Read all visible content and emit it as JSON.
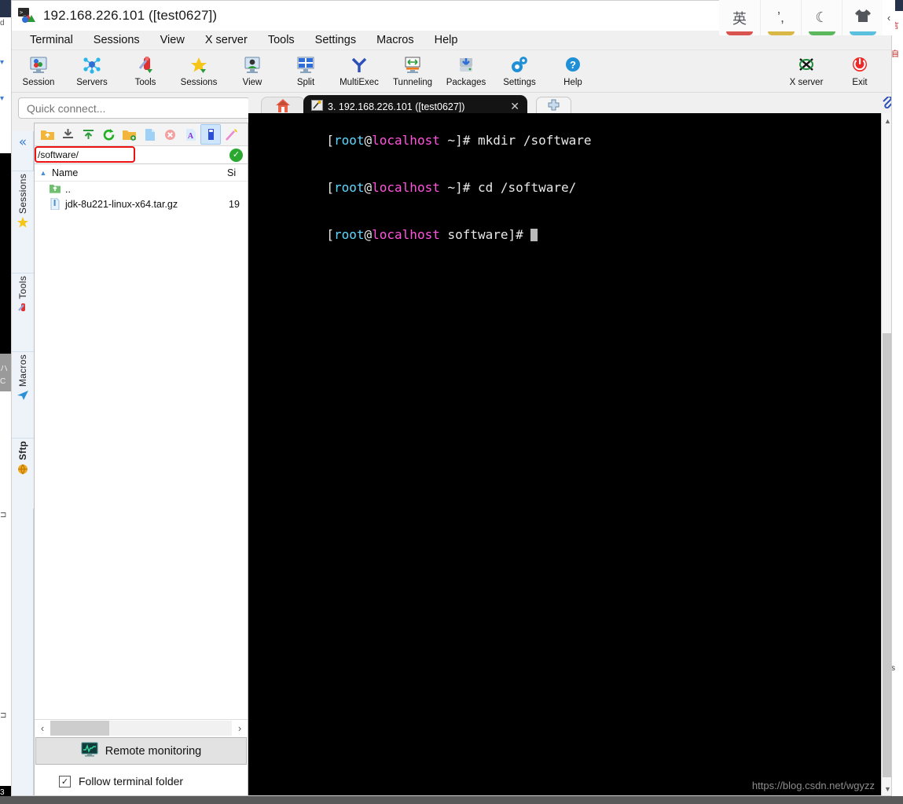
{
  "window": {
    "title": "192.168.226.101 ([test0627])",
    "app_icon": "mobaxterm-icon"
  },
  "menubar": {
    "items": [
      {
        "label": "Terminal"
      },
      {
        "label": "Sessions"
      },
      {
        "label": "View"
      },
      {
        "label": "X server"
      },
      {
        "label": "Tools"
      },
      {
        "label": "Settings"
      },
      {
        "label": "Macros"
      },
      {
        "label": "Help"
      }
    ]
  },
  "toolbar": {
    "items": [
      {
        "label": "Session",
        "icon": "session-icon"
      },
      {
        "label": "Servers",
        "icon": "servers-icon"
      },
      {
        "label": "Tools",
        "icon": "tools-icon"
      },
      {
        "label": "Sessions",
        "icon": "sessions-star-icon"
      },
      {
        "label": "View",
        "icon": "view-icon"
      },
      {
        "label": "Split",
        "icon": "split-icon"
      },
      {
        "label": "MultiExec",
        "icon": "multiexec-icon"
      },
      {
        "label": "Tunneling",
        "icon": "tunneling-icon"
      },
      {
        "label": "Packages",
        "icon": "packages-icon"
      },
      {
        "label": "Settings",
        "icon": "settings-gear-icon"
      },
      {
        "label": "Help",
        "icon": "help-icon"
      }
    ],
    "right_items": [
      {
        "label": "X server",
        "icon": "xserver-icon"
      },
      {
        "label": "Exit",
        "icon": "exit-power-icon"
      }
    ]
  },
  "quick_connect": {
    "placeholder": "Quick connect...",
    "value": ""
  },
  "vertical_strip": {
    "collapse_icon": "double-chevron-left-icon",
    "sections": [
      {
        "label": "Sessions",
        "icon": "star-icon"
      },
      {
        "label": "Tools",
        "icon": "swiss-knife-icon"
      },
      {
        "label": "Macros",
        "icon": "paper-plane-icon"
      },
      {
        "label": "Sftp",
        "icon": "globe-icon"
      }
    ]
  },
  "sftp": {
    "toolbar_icons": [
      "parent-folder-icon",
      "download-icon",
      "upload-icon",
      "refresh-icon",
      "new-folder-icon",
      "new-file-icon",
      "delete-icon",
      "rename-icon",
      "file-properties-icon",
      "edit-wand-icon"
    ],
    "selected_toolbar_icon_index": 8,
    "path": "/software/",
    "path_status_icon": "check-ok-icon",
    "path_highlight_color": "#ee1111",
    "columns": {
      "name": "Name",
      "size": "Si"
    },
    "sort_arrow": "sort-ascending-icon",
    "rows": [
      {
        "name": "..",
        "size": "",
        "icon": "parent-folder-icon"
      },
      {
        "name": "jdk-8u221-linux-x64.tar.gz",
        "size": "19",
        "icon": "archive-file-icon"
      }
    ],
    "hscroll": {
      "left_arrow": "‹",
      "right_arrow": "›"
    },
    "remote_monitoring": {
      "label": "Remote monitoring",
      "icon": "monitor-graph-icon"
    },
    "follow_terminal_folder": {
      "label": "Follow terminal folder",
      "checked": true,
      "check_glyph": "✓"
    }
  },
  "tabs": {
    "home_icon": "home-icon",
    "session_tab": {
      "label": "3. 192.168.226.101 ([test0627])",
      "icon": "ssh-key-icon",
      "close_glyph": "✕"
    },
    "add_tab_glyph": "✚"
  },
  "terminal": {
    "lines": [
      {
        "prompt_open": "[",
        "user": "root",
        "at": "@",
        "host": "localhost",
        "rest": " ~]# ",
        "command": "mkdir /software"
      },
      {
        "prompt_open": "[",
        "user": "root",
        "at": "@",
        "host": "localhost",
        "rest": " ~]# ",
        "command": "cd /software/"
      },
      {
        "prompt_open": "[",
        "user": "root",
        "at": "@",
        "host": "localhost",
        "rest": " software]# ",
        "command": ""
      }
    ],
    "colors": {
      "user": "#5fd7ff",
      "host": "#ff55dd",
      "text": "#e8e8e8",
      "background": "#000000"
    },
    "watermark": "https://blog.csdn.net/wgyzz",
    "scrollbar": {
      "up_glyph": "▲",
      "down_glyph": "▼"
    },
    "clip_icon": "paperclip-icon"
  },
  "ime": {
    "buttons": [
      {
        "glyph": "英",
        "label": "english-mode",
        "underline_color": "#d9534f"
      },
      {
        "glyph": "’,",
        "label": "punctuation-mode",
        "underline_color": "#d9b846"
      },
      {
        "glyph": "☾",
        "label": "moon-mode",
        "underline_color": "#5cb85c"
      },
      {
        "glyph": "👕",
        "label": "skin-mode",
        "underline_color": "#5bc0de"
      }
    ],
    "collapse_glyph": "‹"
  }
}
